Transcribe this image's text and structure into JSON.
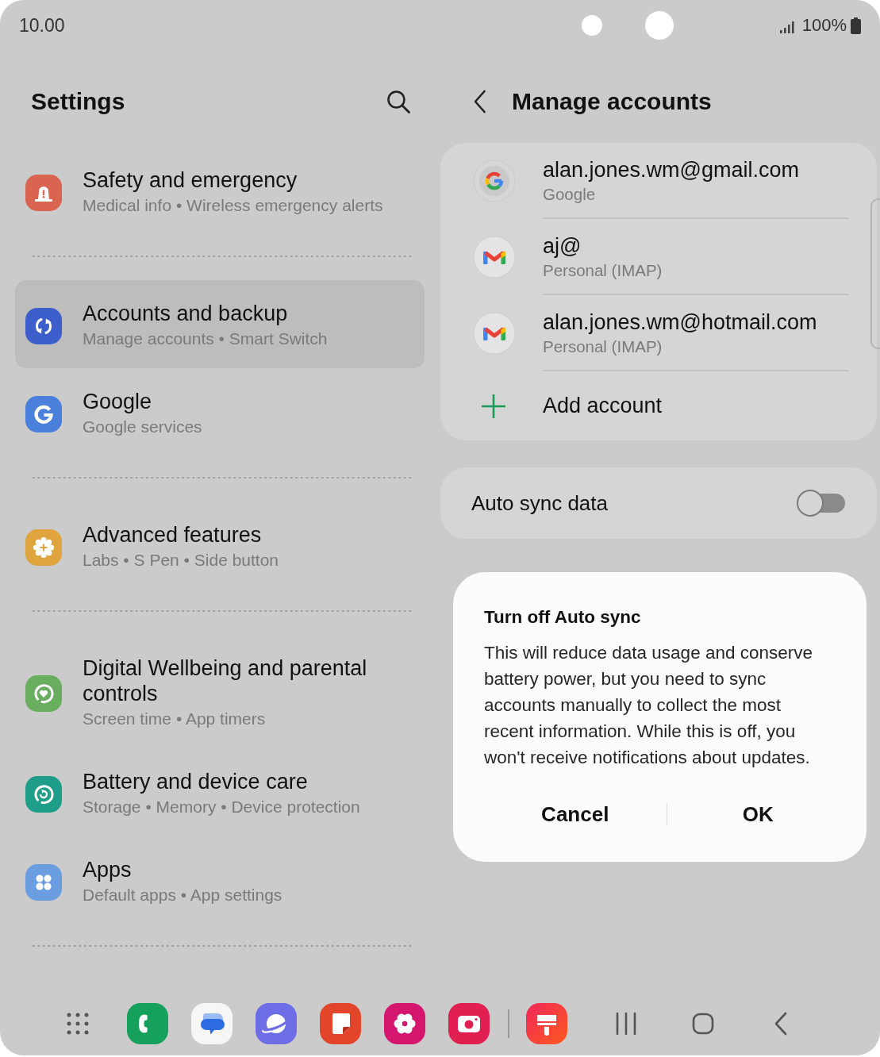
{
  "status_bar": {
    "time": "10.00",
    "battery": "100%"
  },
  "settings": {
    "title": "Settings",
    "groups": [
      {
        "items": [
          {
            "title": "Safety and emergency",
            "subtitle": "Medical info • Wireless emergency alerts",
            "color": "#d9644f",
            "selected": false
          }
        ]
      },
      {
        "items": [
          {
            "title": "Accounts and backup",
            "subtitle": "Manage accounts • Smart Switch",
            "color": "#3d5fcc",
            "selected": true
          },
          {
            "title": "Google",
            "subtitle": "Google services",
            "color": "#4a80dc",
            "selected": false
          }
        ]
      },
      {
        "items": [
          {
            "title": "Advanced features",
            "subtitle": "Labs • S Pen • Side button",
            "color": "#e0a43e",
            "selected": false
          }
        ]
      },
      {
        "items": [
          {
            "title": "Digital Wellbeing and parental controls",
            "subtitle": "Screen time • App timers",
            "color": "#69ad5e",
            "selected": false
          },
          {
            "title": "Battery and device care",
            "subtitle": "Storage • Memory • Device protection",
            "color": "#1e9e88",
            "selected": false
          },
          {
            "title": "Apps",
            "subtitle": "Default apps • App settings",
            "color": "#6b9ee0",
            "selected": false
          }
        ]
      }
    ]
  },
  "manage_accounts": {
    "title": "Manage accounts",
    "accounts": [
      {
        "email": "alan.jones.wm@gmail.com",
        "type": "Google"
      },
      {
        "email": "aj@",
        "type": "Personal (IMAP)"
      },
      {
        "email": "alan.jones.wm@hotmail.com",
        "type": "Personal (IMAP)"
      }
    ],
    "add_account": "Add account",
    "auto_sync": {
      "label": "Auto sync data",
      "on": false
    }
  },
  "dialog": {
    "title": "Turn off Auto sync",
    "message": "This will reduce data usage and conserve battery power, but you need to sync accounts manually to collect the most recent information. While this is off, you won't receive notifications about updates.",
    "buttons": [
      {
        "label": "Cancel"
      },
      {
        "label": "OK"
      }
    ]
  }
}
